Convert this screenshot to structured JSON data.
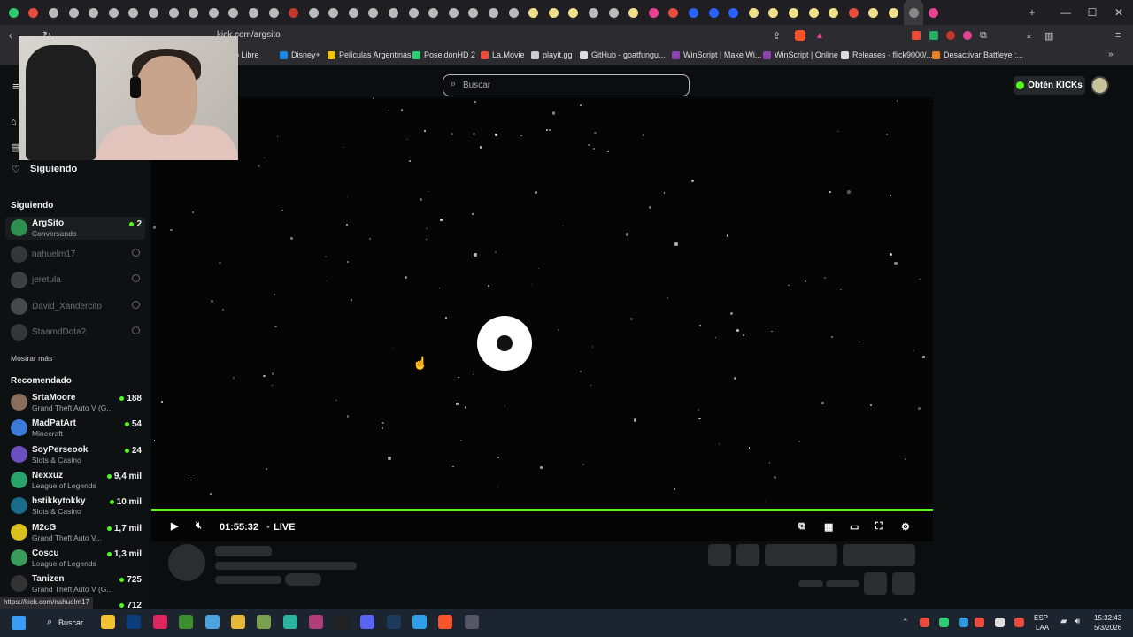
{
  "browser": {
    "url": "kick.com/argsito",
    "bookmarks": [
      "ado Libre",
      "Disney+",
      "Películas Argentinas",
      "PoseidonHD 2",
      "La.Movie",
      "playit.gg",
      "GitHub - goatfungu...",
      "WinScript | Make Wi...",
      "WinScript | Online",
      "Releases · flick9000/...",
      "Desactivar Battleye :..."
    ],
    "status_url": "https://kick.com/nahuelm17"
  },
  "header": {
    "search_placeholder": "Buscar",
    "kicks_button": "Obtén KICKs"
  },
  "sidebar": {
    "following_nav": "Siguiendo",
    "following_header": "Siguiendo",
    "following": [
      {
        "name": "ArgSito",
        "category": "Conversando",
        "viewers": "2",
        "live": true
      },
      {
        "name": "nahuelm17",
        "live": false
      },
      {
        "name": "jeretula",
        "live": false
      },
      {
        "name": "David_Xandercito",
        "live": false
      },
      {
        "name": "StaamdDota2",
        "live": false
      }
    ],
    "show_more": "Mostrar más",
    "recommended_header": "Recomendado",
    "recommended": [
      {
        "name": "SrtaMoore",
        "category": "Grand Theft Auto V (G...",
        "viewers": "188"
      },
      {
        "name": "MadPatArt",
        "category": "Minecraft",
        "viewers": "54"
      },
      {
        "name": "SoyPerseook",
        "category": "Slots & Casino",
        "viewers": "24"
      },
      {
        "name": "Nexxuz",
        "category": "League of Legends",
        "viewers": "9,4 mil"
      },
      {
        "name": "hstikkytokky",
        "category": "Slots & Casino",
        "viewers": "10 mil"
      },
      {
        "name": "M2cG",
        "category": "Grand Theft Auto V...",
        "viewers": "1,7 mil"
      },
      {
        "name": "Coscu",
        "category": "League of Legends",
        "viewers": "1,3 mil"
      },
      {
        "name": "Tanizen",
        "category": "Grand Theft Auto V (G...",
        "viewers": "725"
      },
      {
        "name": "",
        "category": "",
        "viewers": "712"
      }
    ]
  },
  "player": {
    "time": "01:55:32",
    "live_label": "LIVE"
  },
  "taskbar": {
    "search_label": "Buscar",
    "lang_top": "ESP",
    "lang_bottom": "LAA",
    "time": "15:32:43",
    "date": "5/3/2026"
  },
  "colors": {
    "kick_green": "#53fc18",
    "background": "#0b0e0f",
    "sidebar": "#0e1112"
  }
}
